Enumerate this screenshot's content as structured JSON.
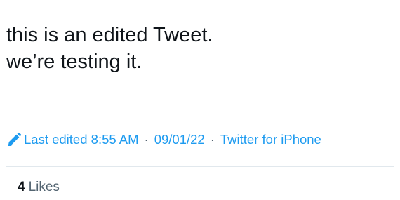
{
  "tweet": {
    "text_lines": [
      "this is an edited Tweet.",
      "we’re testing it."
    ]
  },
  "meta": {
    "edit_label": "Last edited 8:55 AM",
    "separator": "·",
    "date": "09/01/22",
    "source": "Twitter for iPhone"
  },
  "stats": {
    "likes_count": "4",
    "likes_label": "Likes"
  },
  "icons": {
    "edit": "pencil-icon"
  },
  "colors": {
    "accent": "#1d9bf0",
    "text": "#0f1419",
    "secondary": "#536471",
    "divider": "#e1e8ed"
  }
}
